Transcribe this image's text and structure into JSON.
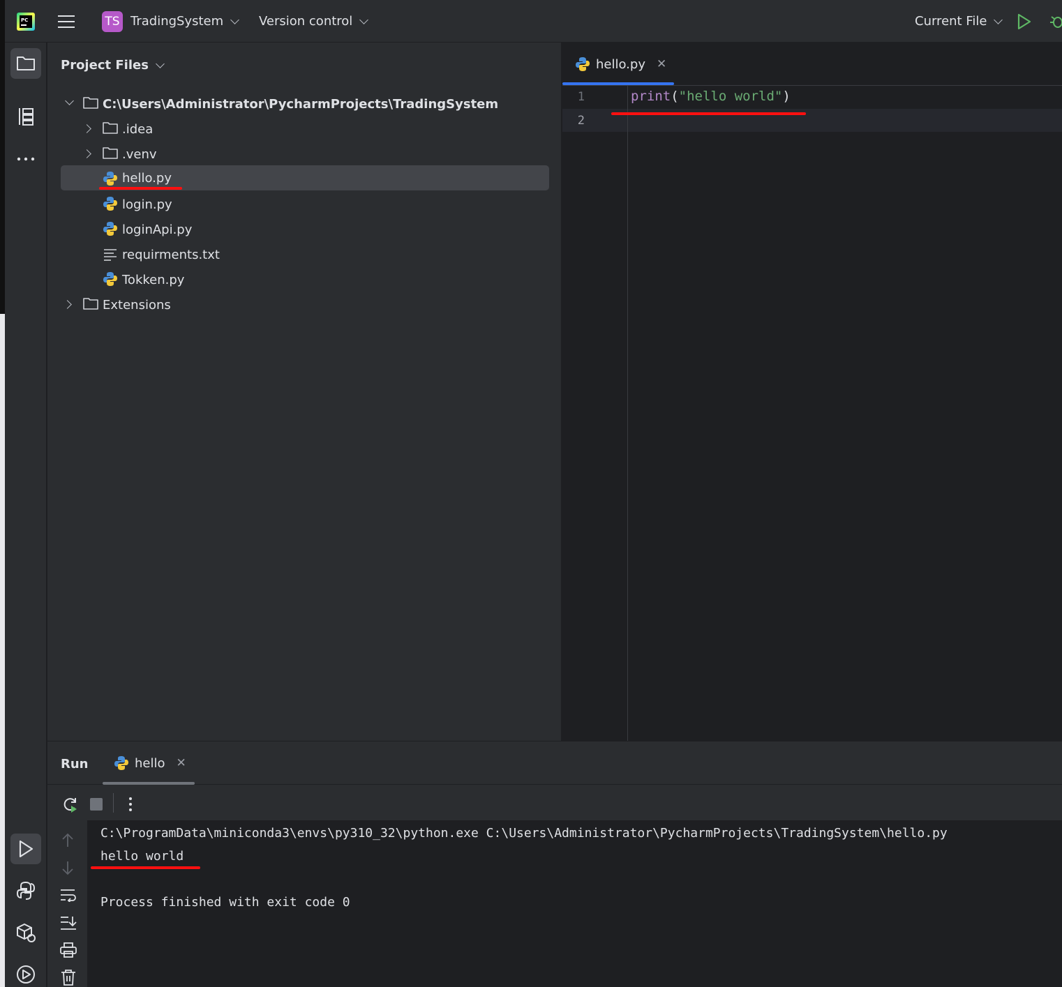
{
  "titlebar": {
    "project_badge": "TS",
    "project_name": "TradingSystem",
    "vcs": "Version control",
    "run_config": "Current File"
  },
  "project_panel": {
    "title": "Project Files",
    "root": "C:\\Users\\Administrator\\PycharmProjects\\TradingSystem",
    "items": [
      {
        "label": ".idea",
        "type": "folder"
      },
      {
        "label": ".venv",
        "type": "folder"
      },
      {
        "label": "hello.py",
        "type": "python",
        "selected": true
      },
      {
        "label": "login.py",
        "type": "python"
      },
      {
        "label": "loginApi.py",
        "type": "python"
      },
      {
        "label": "requirments.txt",
        "type": "text"
      },
      {
        "label": "Tokken.py",
        "type": "python"
      }
    ],
    "extensions": "Extensions"
  },
  "editor": {
    "tab_label": "hello.py",
    "lines": [
      "1",
      "2"
    ],
    "code": {
      "keyword": "print",
      "open": "(",
      "string": "\"hello world\"",
      "close": ")"
    }
  },
  "run_panel": {
    "title": "Run",
    "tab_label": "hello",
    "console": {
      "command": "C:\\ProgramData\\miniconda3\\envs\\py310_32\\python.exe C:\\Users\\Administrator\\PycharmProjects\\TradingSystem\\hello.py",
      "output": "hello world",
      "exit": "Process finished with exit code 0"
    }
  },
  "colors": {
    "accent": "#3574f0",
    "annotation": "#ff1010",
    "keyword": "#b389c9",
    "string": "#6aab73",
    "run_green": "#5fb865"
  }
}
